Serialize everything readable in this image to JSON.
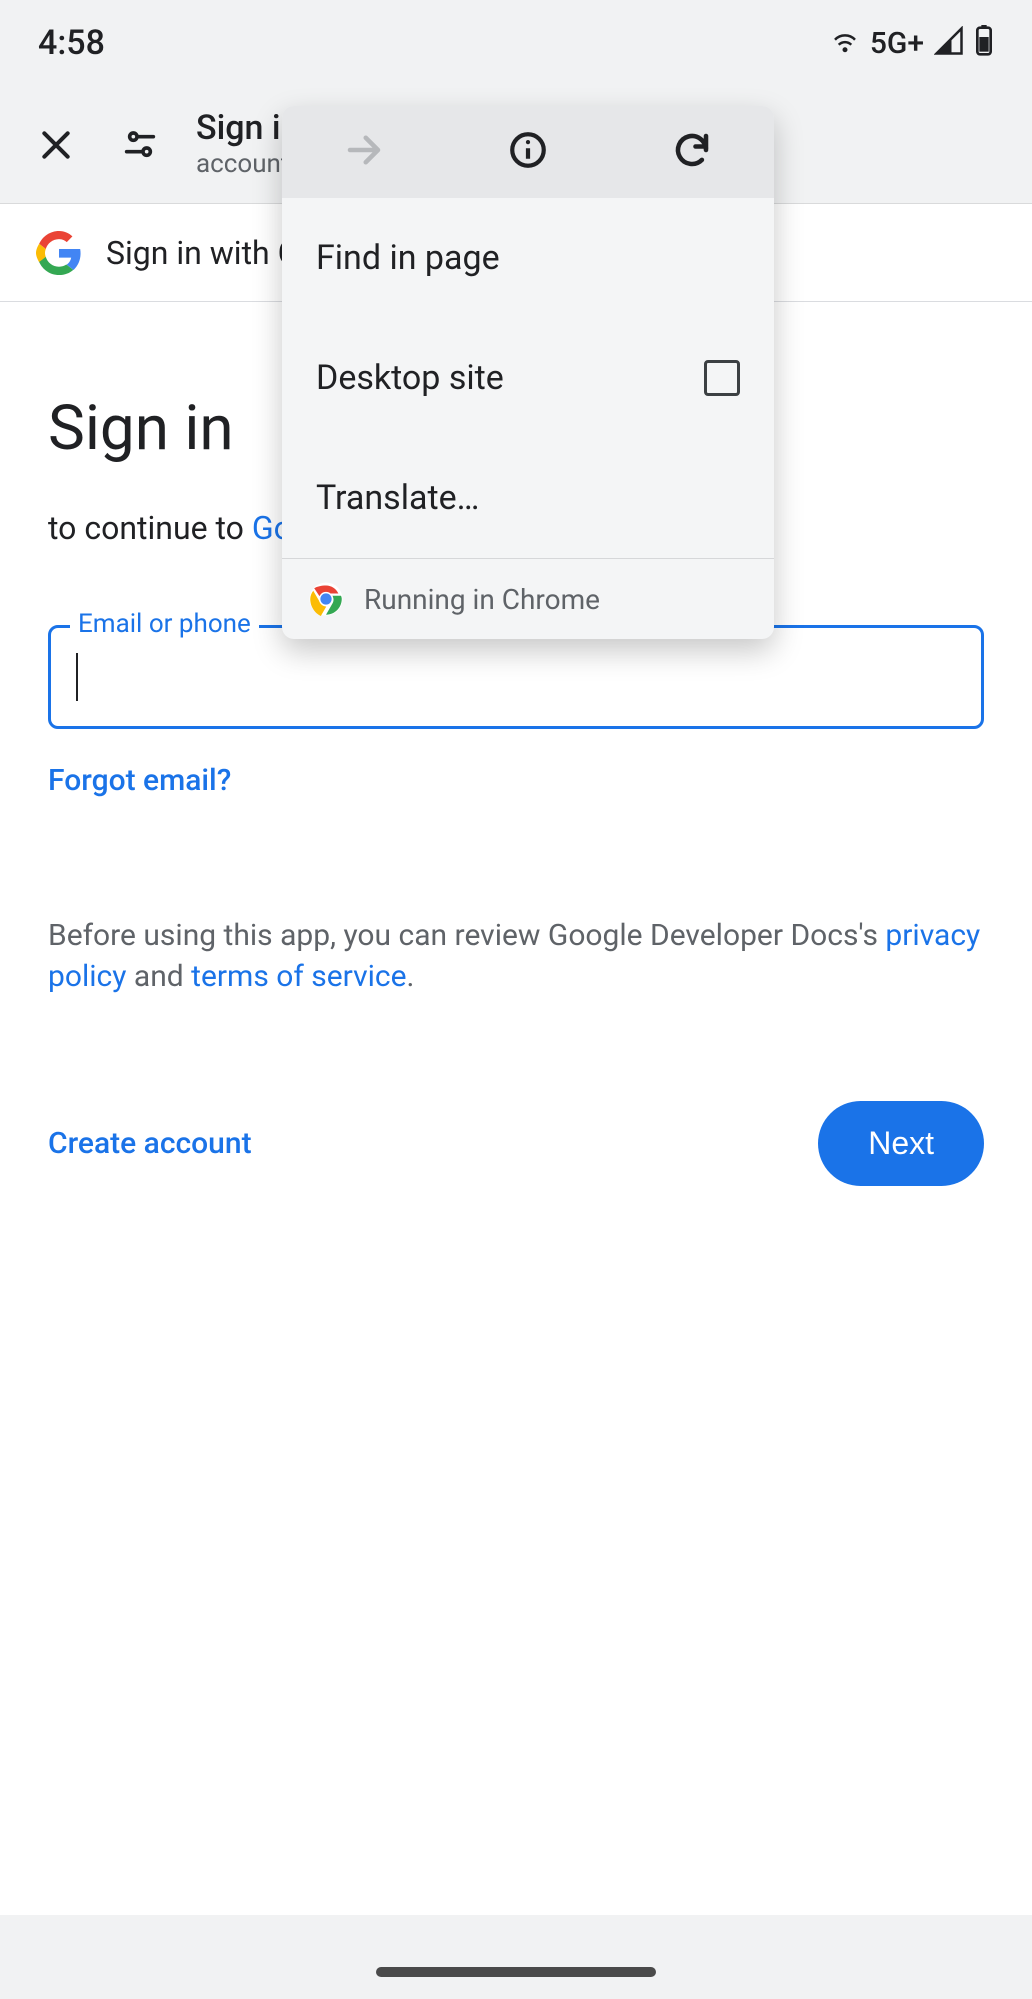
{
  "status": {
    "time": "4:58",
    "network_label": "5G+"
  },
  "toolbar": {
    "title": "Sign in",
    "subtitle": "accounts."
  },
  "banner": {
    "text": "Sign in with Google"
  },
  "page": {
    "heading": "Sign in",
    "continue_prefix": "to continue to ",
    "continue_target": "Google",
    "field_label": "Email or phone",
    "email_value": "",
    "forgot_label": "Forgot email?",
    "disclosure_prefix": "Before using this app, you can review Google Developer Docs's ",
    "privacy_label": "privacy policy",
    "disclosure_mid": " and ",
    "tos_label": "terms of service",
    "disclosure_suffix": ".",
    "create_label": "Create account",
    "next_label": "Next"
  },
  "menu": {
    "find_label": "Find in page",
    "desktop_label": "Desktop site",
    "desktop_checked": false,
    "translate_label": "Translate…",
    "footer_label": "Running in Chrome"
  },
  "icons": {
    "hotspot": "hotspot-icon",
    "signal": "cell-signal-icon",
    "battery": "battery-icon",
    "close": "close-icon",
    "tune": "filter-icon",
    "forward": "forward-icon",
    "info": "info-icon",
    "reload": "reload-icon",
    "chrome": "chrome-icon",
    "google_g": "google-g-icon"
  }
}
